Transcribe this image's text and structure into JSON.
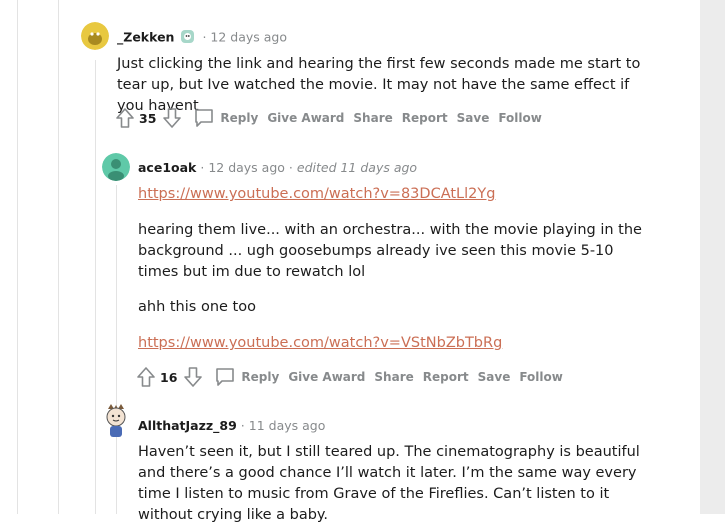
{
  "comments": [
    {
      "username": "_Zekken",
      "age": "12 days ago",
      "body": "Just clicking the link and hearing the first few seconds made me start to tear up, but Ive watched the movie. It may not have the same effect if you havent",
      "score": "35",
      "avatar_color": "#e8c840"
    },
    {
      "username": "ace1oak",
      "age": "12 days ago",
      "edited": "edited 11 days ago",
      "link1": "https://www.youtube.com/watch?v=83DCAtLl2Yg",
      "para1": "hearing them live... with an orchestra... with the movie playing in the background ... ugh goosebumps already ive seen this movie 5-10 times but im due to rewatch lol",
      "para2": "ahh this one too",
      "link2": "https://www.youtube.com/watch?v=VStNbZbTbRg",
      "score": "16",
      "avatar_color": "#5fc9a8"
    },
    {
      "username": "AllthatJazz_89",
      "age": "11 days ago",
      "body": "Haven’t seen it, but I still teared up. The cinematography is beautiful and there’s a good chance I’ll watch it later. I’m the same way every time I listen to music from Grave of the Fireflies. Can’t listen to it without crying like a baby."
    }
  ],
  "actions": {
    "reply": "Reply",
    "give_award": "Give Award",
    "share": "Share",
    "report": "Report",
    "save": "Save",
    "follow": "Follow"
  },
  "separator": "·",
  "colors": {
    "link": "#cb6f55",
    "meta": "#878a8c",
    "thread_line": "#e3e3e3"
  }
}
